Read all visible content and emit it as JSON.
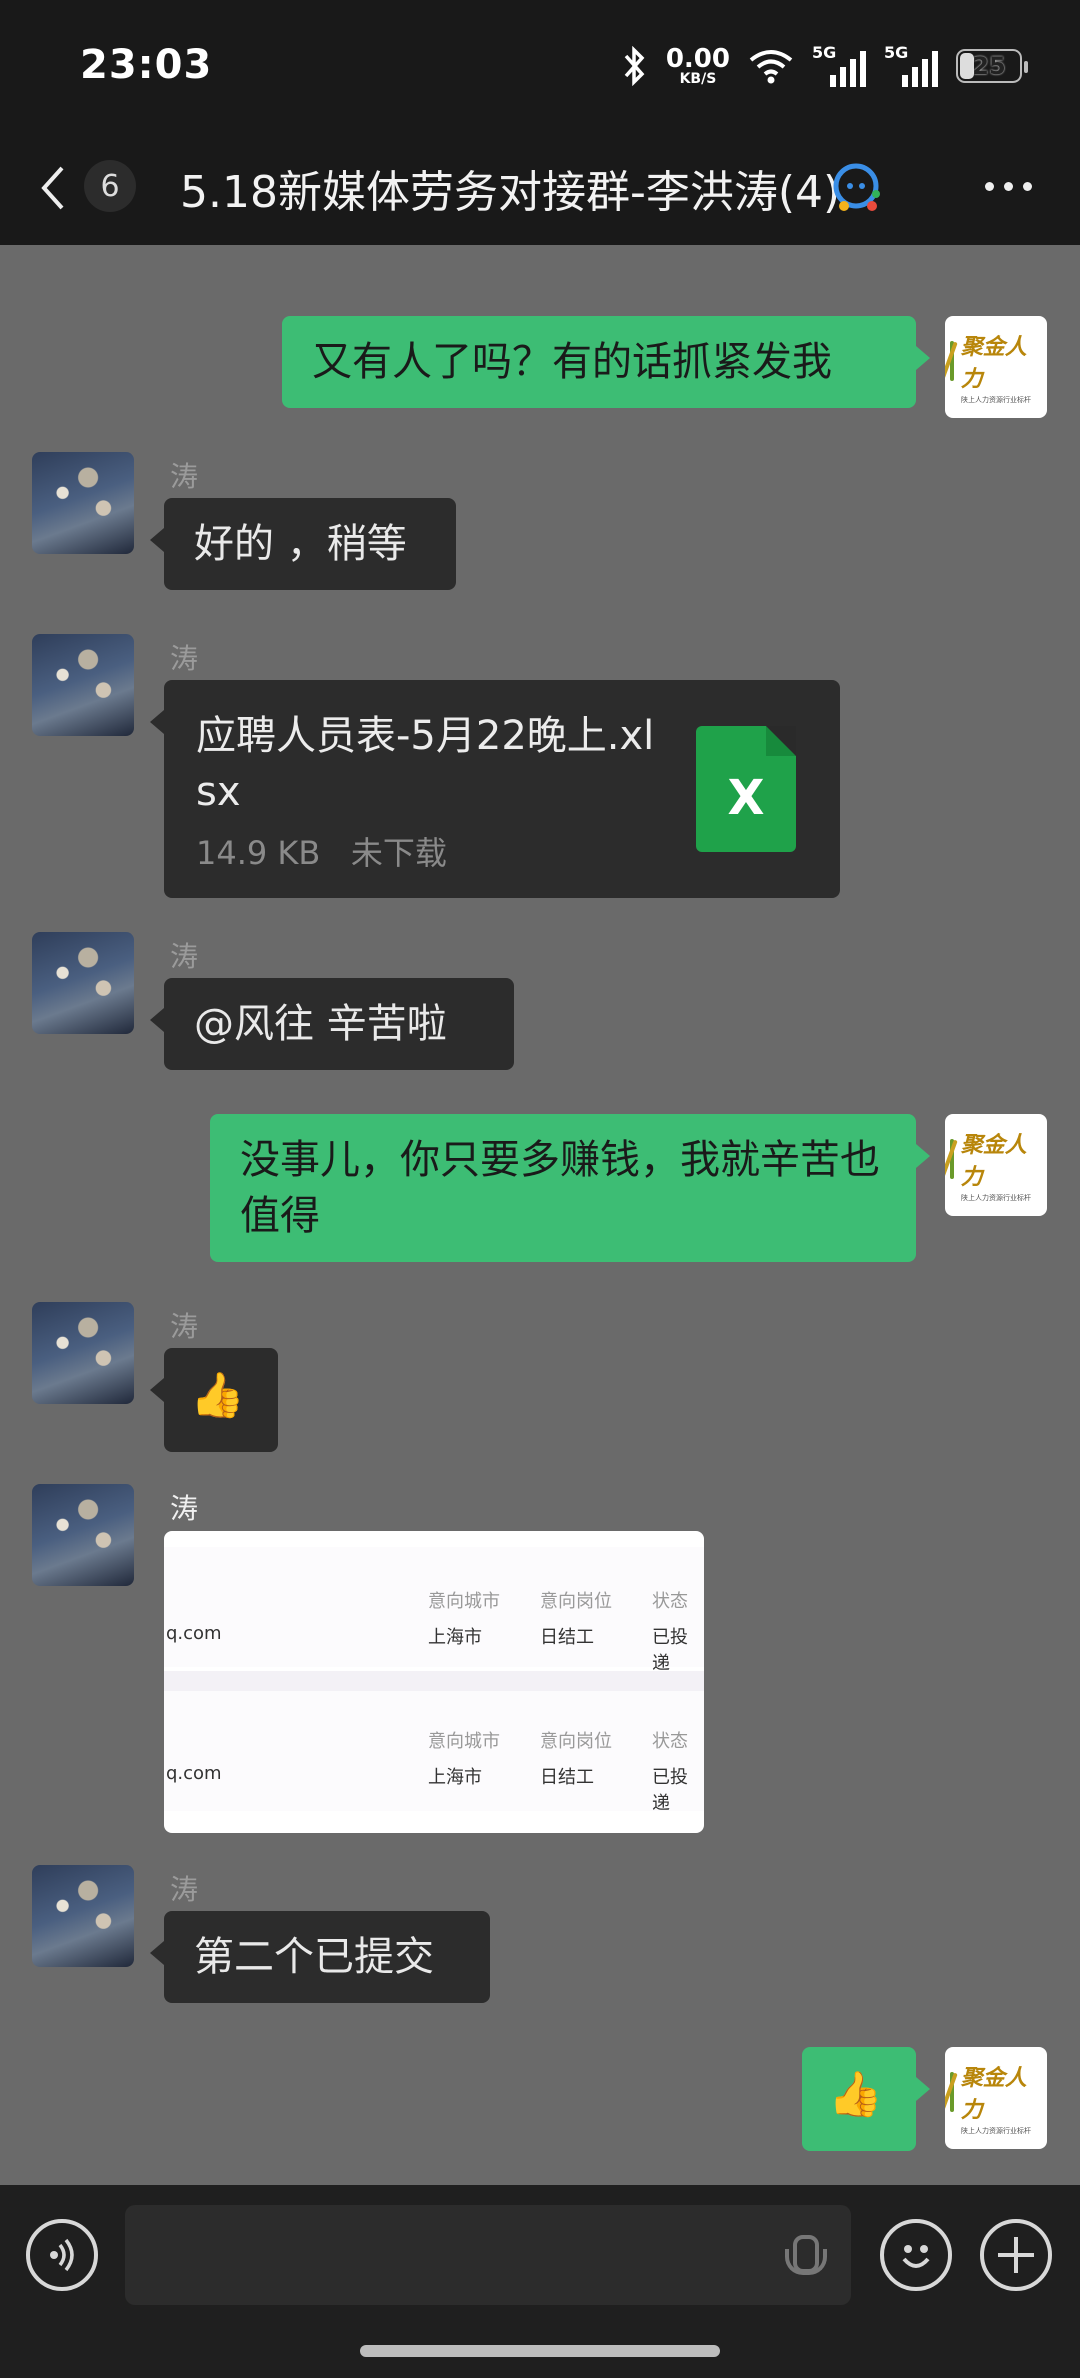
{
  "status_bar": {
    "time": "23:03",
    "net_speed": "0.00",
    "net_speed_unit": "KB/S",
    "sim1_label": "5G",
    "sim2_label": "5G",
    "battery_level": "25"
  },
  "header": {
    "back_count": "6",
    "title": "5.18新媒体劳务对接群-李洪涛(4)"
  },
  "logo": {
    "text": "聚金人力",
    "subtitle": "陕上人力资源行业标杆"
  },
  "messages": [
    {
      "sender": "me",
      "text": "又有人了吗？有的话抓紧发我"
    },
    {
      "sender": "涛",
      "text": "好的 ，稍等"
    },
    {
      "sender": "涛",
      "type": "file",
      "file_name": "应聘人员表-5月22晚上.xlsx",
      "file_size": "14.9 KB",
      "file_status": "未下载",
      "file_icon_letter": "X"
    },
    {
      "sender": "涛",
      "text": "@风往  辛苦啦"
    },
    {
      "sender": "me",
      "text": "没事儿，你只要多赚钱，我就辛苦也值得"
    },
    {
      "sender": "涛",
      "type": "emoji",
      "emoji": "👍"
    },
    {
      "sender": "涛",
      "type": "image",
      "rows": [
        {
          "email": "q.com",
          "city_header": "意向城市",
          "job_header": "意向岗位",
          "status_header": "状态",
          "city": "上海市",
          "job": "日结工",
          "status": "已投递"
        },
        {
          "email": "q.com",
          "city_header": "意向城市",
          "job_header": "意向岗位",
          "status_header": "状态",
          "city": "上海市",
          "job": "日结工",
          "status": "已投递"
        }
      ]
    },
    {
      "sender": "涛",
      "text": "第二个已提交"
    },
    {
      "sender": "me",
      "type": "emoji",
      "emoji": "👍"
    }
  ],
  "sender_name": "涛"
}
